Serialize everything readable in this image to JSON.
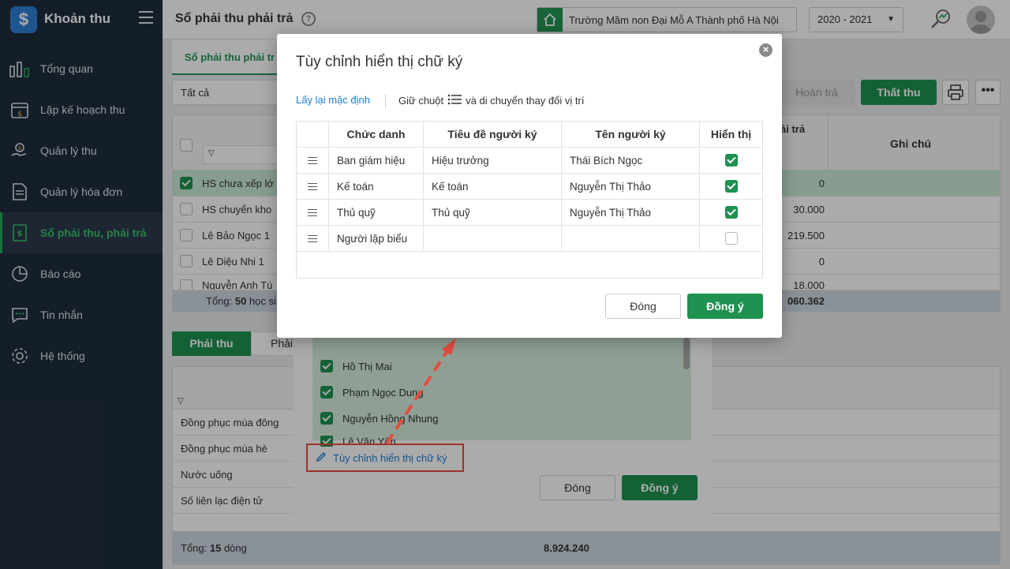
{
  "sidebar": {
    "app_name": "Khoản thu",
    "logo": "$",
    "items": [
      {
        "label": "Tổng quan",
        "icon": "bar-chart-icon"
      },
      {
        "label": "Lập kế hoạch thu",
        "icon": "calendar-money-icon"
      },
      {
        "label": "Quản lý thu",
        "icon": "hand-money-icon"
      },
      {
        "label": "Quản lý hóa đơn",
        "icon": "document-icon"
      },
      {
        "label": "Sổ phải thu, phải trả",
        "icon": "ledger-icon",
        "active": true
      },
      {
        "label": "Báo cáo",
        "icon": "pie-chart-icon"
      },
      {
        "label": "Tin nhắn",
        "icon": "chat-icon"
      },
      {
        "label": "Hệ thống",
        "icon": "gear-icon"
      }
    ]
  },
  "header": {
    "title": "Sổ phải thu phải trả",
    "help": "?",
    "school": "Trường Mầm non Đại Mỗ A Thành phố Hà Nội",
    "year": "2020 - 2021"
  },
  "main": {
    "tab": "Sổ phải thu phải tr",
    "filter": "Tất cả",
    "btn_return": "Hoàn trả",
    "btn_loss": "Thất thu",
    "col_payable": "ải trả",
    "col_note": "Ghi chú",
    "rows": [
      {
        "name": "HS chưa xếp lớ",
        "amount": "0",
        "checked": true
      },
      {
        "name": "HS chuyển kho",
        "amount": "30.000",
        "checked": false
      },
      {
        "name": "Lê Bảo Ngọc 1",
        "amount": "219.500",
        "checked": false
      },
      {
        "name": "Lê Diệu Nhi 1",
        "amount": "0",
        "checked": false
      },
      {
        "name": "Nguyễn Anh Tú",
        "amount": "18.000",
        "checked": false
      }
    ],
    "total_prefix": "Tổng: ",
    "total_count": "50",
    "total_suffix": " học si",
    "total_amount": "060.362",
    "sub_tab_active": "Phải thu",
    "sub_tab_2": "Phải",
    "sub_rows": [
      "Đồng phục mùa đông",
      "Đồng phục mùa hè",
      "Nước uống",
      "Số liên lạc điện tử"
    ],
    "sub_total_prefix": "Tổng: ",
    "sub_total_count": "15",
    "sub_total_suffix": " dòng",
    "sub_total_amount": "8.924.240"
  },
  "back_dialog": {
    "people": [
      "Hồ Thị Mai",
      "Phạm Ngọc Dung",
      "Nguyễn Hồng Nhung",
      "Lê Văn Yên"
    ],
    "customize_link": "Tùy chỉnh hiển thị chữ ký",
    "close": "Đóng",
    "ok": "Đồng ý"
  },
  "dialog": {
    "title": "Tùy chỉnh hiển thị chữ ký",
    "reset": "Lấy lại mặc định",
    "hint_before": "Giữ chuột",
    "hint_after": "và di chuyển thay đổi vị trí",
    "headers": [
      "Chức danh",
      "Tiêu đề người ký",
      "Tên người ký",
      "Hiển thị"
    ],
    "rows": [
      {
        "role": "Ban giám hiệu",
        "title": "Hiệu trưởng",
        "name": "Thái Bích Ngọc",
        "show": true
      },
      {
        "role": "Kế toán",
        "title": "Kế toán",
        "name": "Nguyễn Thị Thảo",
        "show": true
      },
      {
        "role": "Thủ quỹ",
        "title": "Thủ quỹ",
        "name": "Nguyễn Thị Thảo",
        "show": true
      },
      {
        "role": "Người lập biểu",
        "title": "",
        "name": "",
        "show": false
      }
    ],
    "close": "Đóng",
    "ok": "Đồng ý"
  },
  "colors": {
    "primary_green": "#1f9151",
    "sidebar_bg": "#1f2d3d",
    "link_blue": "#1a7fd6",
    "highlight_red": "#e74c3c"
  }
}
